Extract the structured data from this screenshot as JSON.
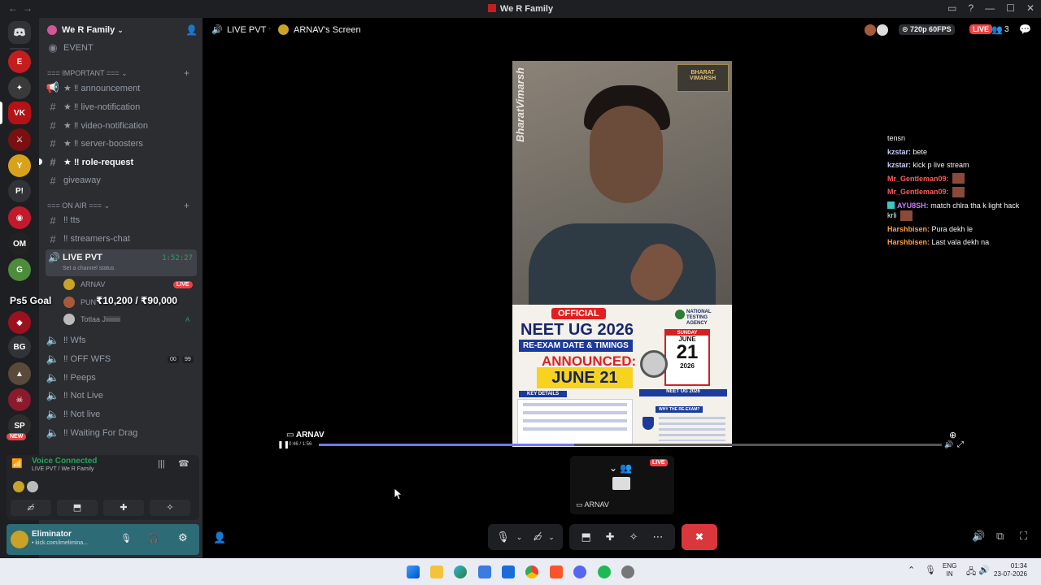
{
  "window": {
    "title": "We R Family"
  },
  "server": {
    "name": "We R Family"
  },
  "channels": {
    "event": "EVENT",
    "cat_important": "IMPORTANT",
    "announcement": "★ ‼ announcement",
    "live_notification": "★ ‼ live-notification",
    "video_notification": "★ ‼ video-notification",
    "server_boosters": "★ ‼ server-boosters",
    "role_request": "★ ‼ role-request",
    "giveaway": "giveaway",
    "cat_onair": "ON AIR",
    "tts": "‼ tts",
    "streamers_chat": "‼ streamers-chat",
    "live_pvt": "LIVE PVT",
    "live_pvt_timer": "1:52:27",
    "live_pvt_status": "Set a channel status",
    "wfs": "‼ Wfs",
    "off_wfs": "‼ OFF WFS",
    "off_wfs_count_a": "00",
    "off_wfs_count_b": "99",
    "peeps": "‼ Peeps",
    "not_live_1": "‼ Not Live",
    "not_live_2": "‼ Not live",
    "waiting": "‼ Waiting For Drag"
  },
  "voice_users": [
    {
      "name": "ARNAV",
      "badge": "LIVE"
    },
    {
      "name": "PUN"
    },
    {
      "name": "Totlaa Jiiiiiiiii",
      "badge": "A"
    }
  ],
  "overlay": {
    "goal_label": "Ps5 Goal",
    "goal_value": "₹10,200 / ₹90,000"
  },
  "voice_connected": {
    "title": "Voice Connected",
    "subtitle": "LIVE PVT / We R Family"
  },
  "user": {
    "name": "Eliminator",
    "status": "• kick.com/imelimina..."
  },
  "new_badge": "NEW",
  "guild_labels": {
    "p": "P!",
    "bg": "BG"
  },
  "stage": {
    "channel": "LIVE PVT",
    "screen": "ARNAV's Screen",
    "quality": "720p 60FPS",
    "live": "LIVE",
    "viewers": "3",
    "stream_name": "ARNAV",
    "time": "0:46 / 1:56",
    "mini_name": "ARNAV",
    "mini_live": "LIVE"
  },
  "video": {
    "watermark": "BharatVimarsh",
    "logo": "BHARAT VIMARSH",
    "poster_official": "OFFICIAL",
    "poster_title": "NEET UG 2026",
    "poster_sub": "RE-EXAM DATE & TIMINGS",
    "poster_announced": "ANNOUNCED:",
    "poster_date": "JUNE 21",
    "cal_day": "SUNDAY",
    "cal_month": "JUNE",
    "cal_num": "21",
    "cal_year": "2026",
    "nta": "NATIONAL TESTING AGENCY",
    "key_details": "KEY DETAILS",
    "neet_badge": "NEET UG 2026",
    "why": "WHY THE RE-EXAM?"
  },
  "chat": [
    {
      "user": "tensn",
      "color": "#f2f3f5",
      "msg": ""
    },
    {
      "user": "kzstar:",
      "color": "#c9cdfb",
      "msg": "bete"
    },
    {
      "user": "kzstar:",
      "color": "#c9cdfb",
      "msg": "kick p live stream"
    },
    {
      "user": "Mr_Gentleman09:",
      "color": "#ff5a5a",
      "msg": "",
      "emote": true
    },
    {
      "user": "Mr_Gentleman09:",
      "color": "#ff5a5a",
      "msg": "",
      "emote": true
    },
    {
      "user": "AYU8SH:",
      "color": "#c77dff",
      "msg": "match chlra tha k light hack"
    },
    {
      "user": "",
      "color": "#f2f3f5",
      "msg": "krli",
      "emote": true
    },
    {
      "user": "Harshbisen:",
      "color": "#ff9f43",
      "msg": "Pura dekh le"
    },
    {
      "user": "Harshbisen:",
      "color": "#ff9f43",
      "msg": "Last vala dekh na"
    }
  ],
  "taskbar": {
    "lang": "ENG",
    "region": "IN",
    "time": "01:34",
    "date": "23-07-2026"
  },
  "colors": {
    "accent": "#5865f2",
    "live": "#ed4245",
    "green": "#23a55a",
    "leave": "#da373c"
  }
}
